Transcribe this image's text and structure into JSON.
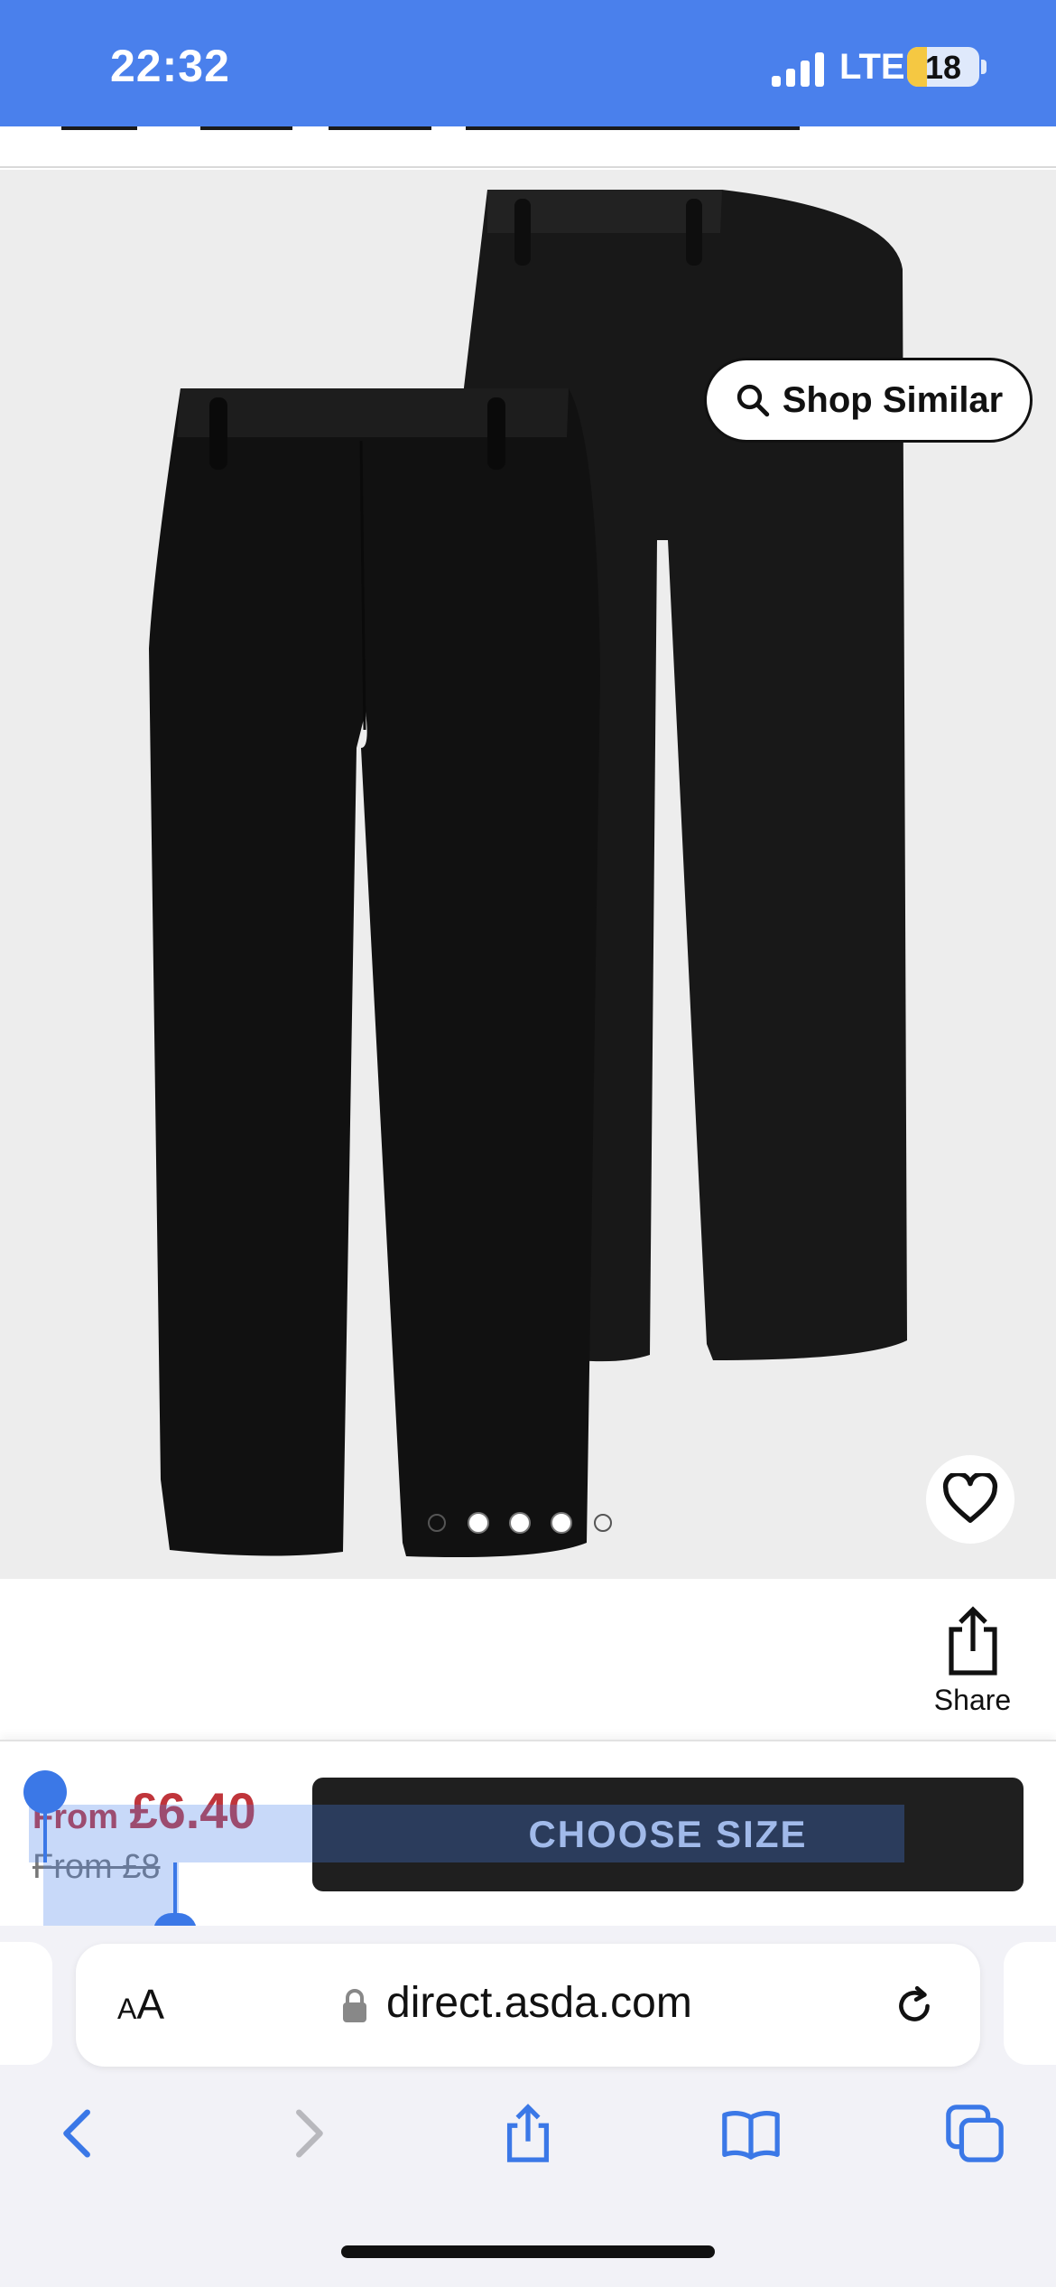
{
  "status_bar": {
    "time": "22:32",
    "network": "LTE",
    "battery_level": "18",
    "icons": [
      "signal-icon",
      "battery-icon"
    ]
  },
  "product": {
    "shop_similar_label": "Shop Similar",
    "image_count": 5,
    "active_image_dots": [
      1,
      2,
      3
    ],
    "share_label": "Share"
  },
  "purchase": {
    "price_prefix": "From",
    "price_now": "£6.40",
    "price_was": "From £8",
    "choose_size_label": "CHOOSE SIZE"
  },
  "browser": {
    "text_size_label_small": "A",
    "text_size_label_large": "A",
    "url": "direct.asda.com"
  },
  "colors": {
    "status_bar": "#4a80ec",
    "price_red": "#c0353b",
    "button_dark": "#1f1f1f",
    "ios_blue": "#3b78e7"
  }
}
